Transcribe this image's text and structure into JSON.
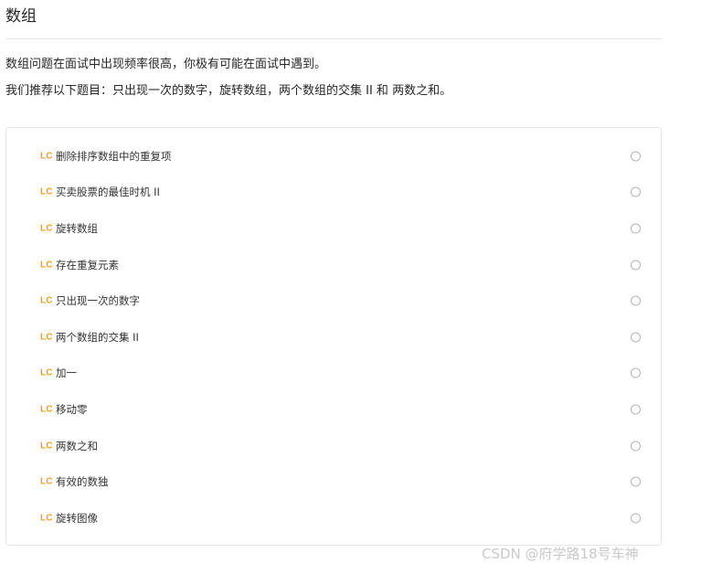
{
  "section": {
    "title": "数组",
    "intro_line1": "数组问题在面试中出现频率很高，你极有可能在面试中遇到。",
    "intro_line2": "我们推荐以下题目：只出现一次的数字，旋转数组，两个数组的交集 II 和 两数之和。"
  },
  "problems": {
    "badge": "LC",
    "items": [
      {
        "label": "删除排序数组中的重复项"
      },
      {
        "label": "买卖股票的最佳时机 II"
      },
      {
        "label": "旋转数组"
      },
      {
        "label": "存在重复元素"
      },
      {
        "label": "只出现一次的数字"
      },
      {
        "label": "两个数组的交集 II"
      },
      {
        "label": "加一"
      },
      {
        "label": "移动零"
      },
      {
        "label": "两数之和"
      },
      {
        "label": "有效的数独"
      },
      {
        "label": "旋转图像"
      }
    ]
  },
  "watermark": "CSDN @府学路18号车神",
  "colors": {
    "badge": "#f0a020",
    "border": "#e6e6e6",
    "status_circle": "#b5b5b5",
    "watermark": "#c9c9c9"
  }
}
